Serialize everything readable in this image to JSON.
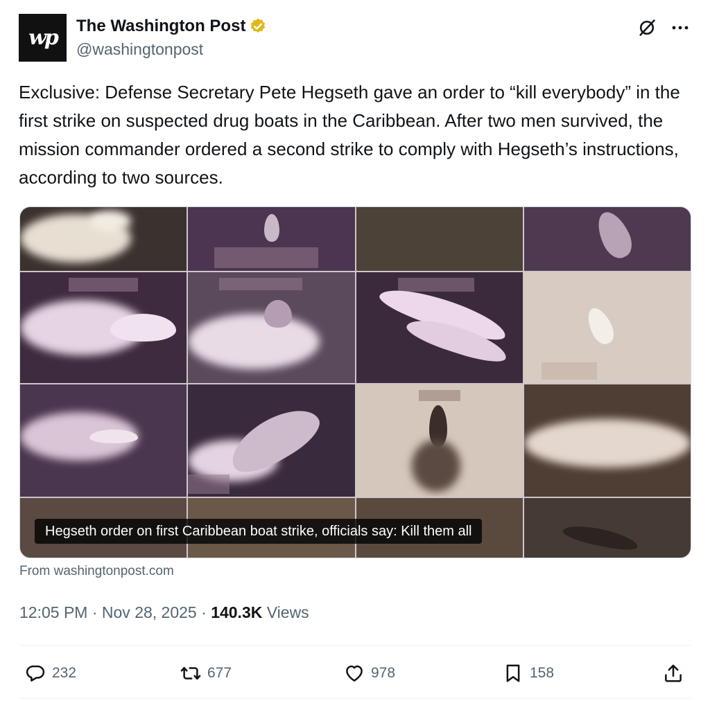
{
  "author": {
    "avatar_text": "wp",
    "display_name": "The Washington Post",
    "handle": "@washingtonpost",
    "verified_color": "#e2b719"
  },
  "tweet": {
    "text": "Exclusive: Defense Secretary Pete Hegseth gave an order to “kill everybody” in the first strike on suspected drug boats in the Caribbean. After two men survived, the mission commander ordered a second strike to comply with Hegseth’s instructions, according to two sources."
  },
  "card": {
    "caption": "Hegseth order on first Caribbean boat strike, officials say: Kill them all",
    "source": "From washingtonpost.com"
  },
  "meta": {
    "time": "12:05 PM",
    "date": "Nov 28, 2025",
    "views_count": "140.3K",
    "views_label": "Views"
  },
  "actions": {
    "replies": "232",
    "reposts": "677",
    "likes": "978",
    "bookmarks": "158"
  },
  "icons": [
    "verified-badge-icon",
    "grok-icon",
    "more-icon",
    "reply-icon",
    "repost-icon",
    "like-icon",
    "bookmark-icon",
    "share-icon"
  ]
}
